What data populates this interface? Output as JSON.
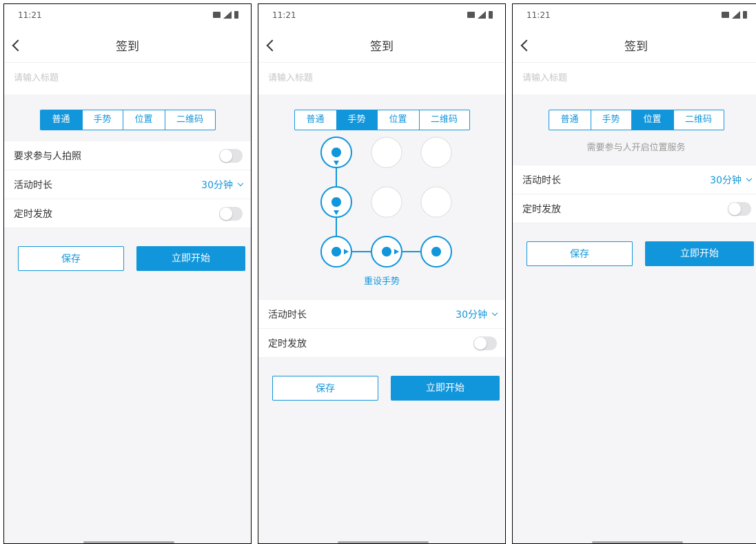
{
  "status": {
    "time": "11:21"
  },
  "nav": {
    "title": "签到"
  },
  "form": {
    "title_placeholder": "请输入标题",
    "tabs": [
      "普通",
      "手势",
      "位置",
      "二维码"
    ],
    "require_photo_label": "要求参与人拍照",
    "duration_label": "活动时长",
    "duration_value": "30分钟",
    "scheduled_label": "定时发放",
    "save_label": "保存",
    "start_label": "立即开始"
  },
  "gesture": {
    "reset_label": "重设手势"
  },
  "location": {
    "note": "需要参与人开启位置服务"
  },
  "colors": {
    "accent": "#1296db",
    "bg": "#f5f5f7"
  }
}
